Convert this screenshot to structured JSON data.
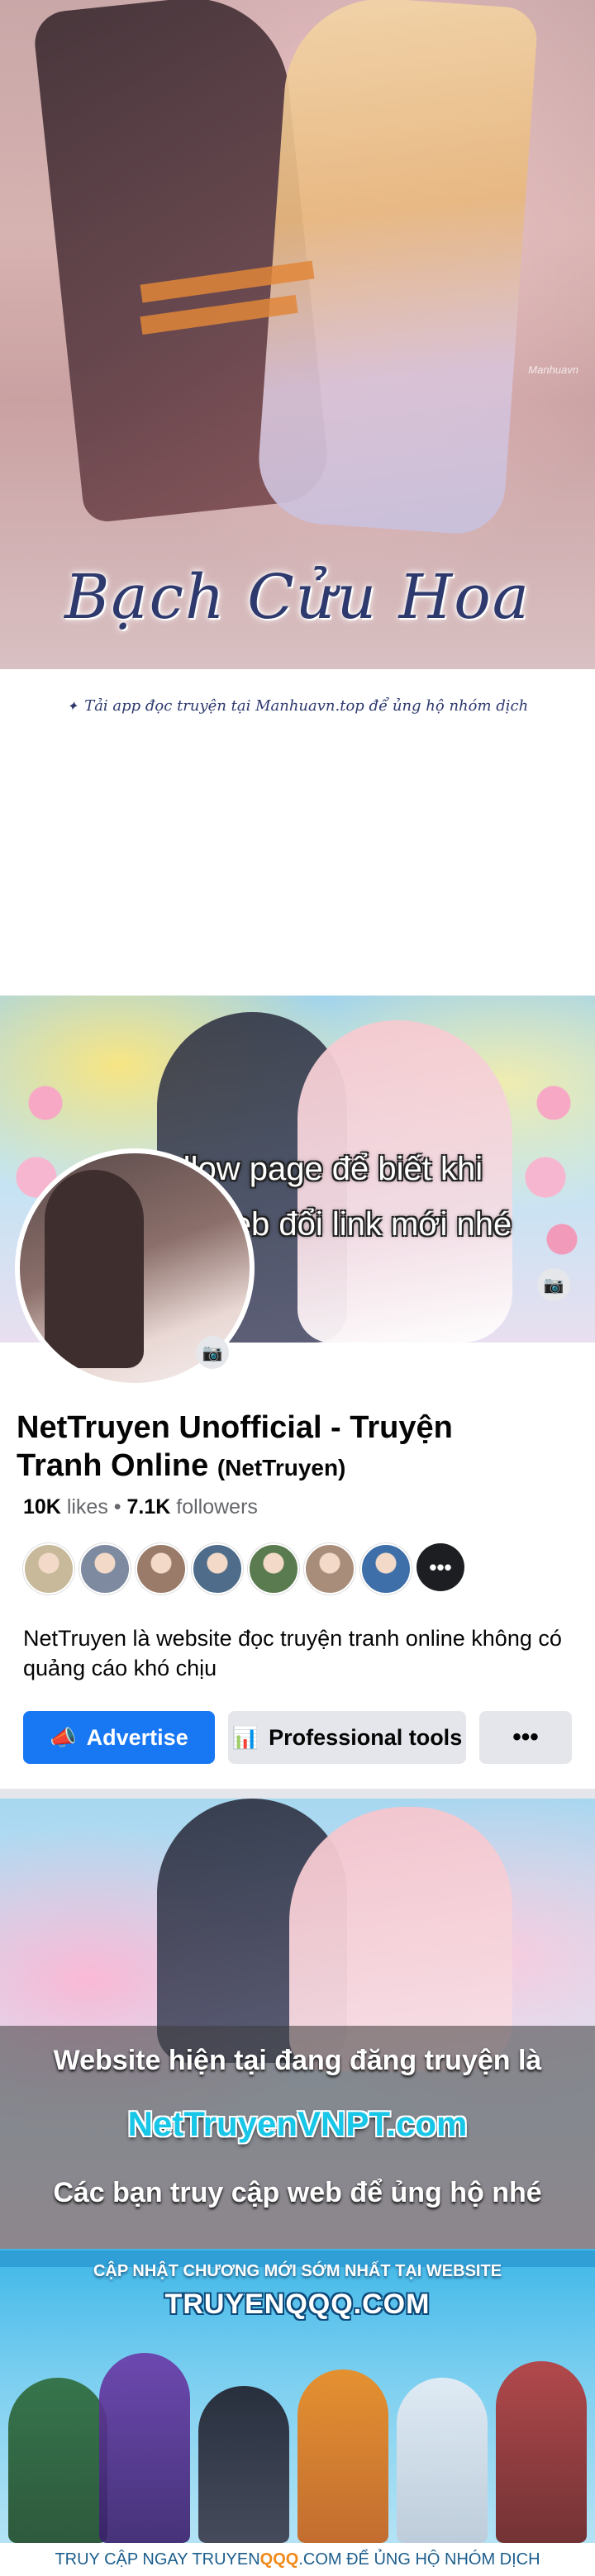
{
  "manga": {
    "watermark": "Manhuavn",
    "title": "Bạch Cửu Hoa",
    "subline": "Tải app đọc truyện tại Manhuavn.top để ủng hộ nhóm dịch"
  },
  "facebook": {
    "cover_text_line1": "Follow page để biết khi",
    "cover_text_line2": "nào web đổi link mới nhé",
    "page_name": "NetTruyen Unofficial - Truyện Tranh Online",
    "page_alias": "(NetTruyen)",
    "likes_count": "10K",
    "likes_label": "likes",
    "followers_count": "7.1K",
    "followers_label": "followers",
    "friend_avatar_colors": [
      "#c8b99a",
      "#7d8aa0",
      "#9a7b6a",
      "#4f6d8a",
      "#5a7b4f",
      "#a88e7a",
      "#3e6fa8"
    ],
    "more_label": "•••",
    "about": "NetTruyen là website đọc truyện tranh online không có quảng cáo khó chịu",
    "advertise_label": "Advertise",
    "professional_tools_label": "Professional tools",
    "more_button_label": "•••",
    "accent_color": "#1877f2"
  },
  "banner": {
    "line1": "Website hiện tại đang đăng truyện là",
    "line2": "NetTruyenVNPT.com",
    "line3": "Các bạn truy cập web để ủng hộ nhé"
  },
  "qqq": {
    "line1": "CẬP NHẬT CHƯƠNG MỚI SỚM NHẤT TẠI WEBSITE",
    "line2": "TRUYENQQQ.COM",
    "footer_prefix": "TRUY CẬP NGAY TRUYEN",
    "footer_highlight": "QQQ",
    "footer_suffix": ".COM ĐỂ ỦNG HỘ NHÓM DỊCH"
  }
}
